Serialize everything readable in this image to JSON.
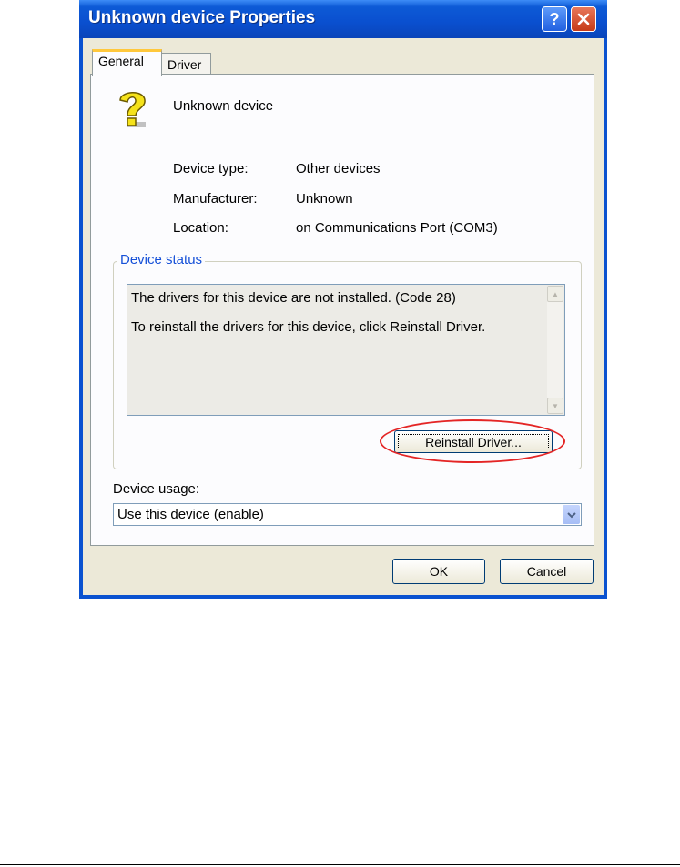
{
  "window": {
    "title": "Unknown device Properties",
    "help_icon": "question-icon",
    "close_icon": "close-icon"
  },
  "tabs": [
    {
      "label": "General",
      "selected": true
    },
    {
      "label": "Driver",
      "selected": false
    }
  ],
  "device": {
    "icon": "unknown-device-question-icon",
    "name": "Unknown device"
  },
  "properties": [
    {
      "label": "Device type:",
      "value": "Other devices"
    },
    {
      "label": "Manufacturer:",
      "value": "Unknown"
    },
    {
      "label": "Location:",
      "value": "on Communications Port (COM3)"
    }
  ],
  "device_status": {
    "legend": "Device status",
    "line1": "The drivers for this device are not installed. (Code 28)",
    "line2": "To reinstall the drivers for this device, click Reinstall Driver.",
    "reinstall_button": "Reinstall Driver...",
    "highlight_color": "#e42525"
  },
  "device_usage": {
    "label": "Device usage:",
    "selected": "Use this device (enable)"
  },
  "buttons": {
    "ok": "OK",
    "cancel": "Cancel"
  },
  "colors": {
    "titlebar": "#0a52d0",
    "dialog_bg": "#ece9d8",
    "legend_text": "#1550d8",
    "tab_highlight": "#ffc83c"
  }
}
